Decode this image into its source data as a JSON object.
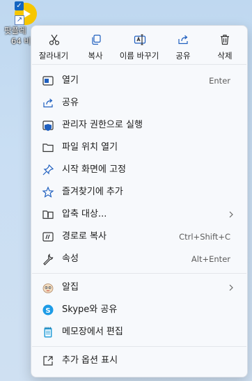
{
  "desktop_icon": {
    "name_line1": "팟플레",
    "name_line2": "64 비",
    "checkbox": "check-icon",
    "shortcut": "shortcut-arrow-icon"
  },
  "toolbar": [
    {
      "id": "cut",
      "label": "잘라내기",
      "icon": "scissors-icon"
    },
    {
      "id": "copy",
      "label": "복사",
      "icon": "copy-icon"
    },
    {
      "id": "rename",
      "label": "이름 바꾸기",
      "icon": "rename-icon"
    },
    {
      "id": "share",
      "label": "공유",
      "icon": "share-icon"
    },
    {
      "id": "delete",
      "label": "삭제",
      "icon": "trash-icon"
    }
  ],
  "items": [
    {
      "label": "열기",
      "shortcut": "Enter",
      "icon": "open-icon"
    },
    {
      "label": "공유",
      "shortcut": "",
      "icon": "share-icon"
    },
    {
      "label": "관리자 권한으로 실행",
      "shortcut": "",
      "icon": "admin-shield-icon"
    },
    {
      "label": "파일 위치 열기",
      "shortcut": "",
      "icon": "folder-icon"
    },
    {
      "label": "시작 화면에 고정",
      "shortcut": "",
      "icon": "pin-icon"
    },
    {
      "label": "즐겨찾기에 추가",
      "shortcut": "",
      "icon": "star-icon"
    },
    {
      "label": "압축 대상...",
      "shortcut": "",
      "icon": "zip-folder-icon",
      "submenu": true
    },
    {
      "label": "경로로 복사",
      "shortcut": "Ctrl+Shift+C",
      "icon": "copy-path-icon"
    },
    {
      "label": "속성",
      "shortcut": "Alt+Enter",
      "icon": "wrench-icon"
    },
    {
      "label": "알집",
      "shortcut": "",
      "icon": "alzip-icon",
      "submenu": true
    },
    {
      "label": "Skype와 공유",
      "shortcut": "",
      "icon": "skype-icon"
    },
    {
      "label": "메모장에서 편집",
      "shortcut": "",
      "icon": "notepad-icon"
    },
    {
      "label": "추가 옵션 표시",
      "shortcut": "",
      "icon": "more-options-icon"
    }
  ],
  "colors": {
    "icon_blue": "#1f5fbf",
    "menu_bg": "#f7f9fc",
    "text": "#1b1b1b",
    "shortcut_text": "#5c5c5c"
  }
}
